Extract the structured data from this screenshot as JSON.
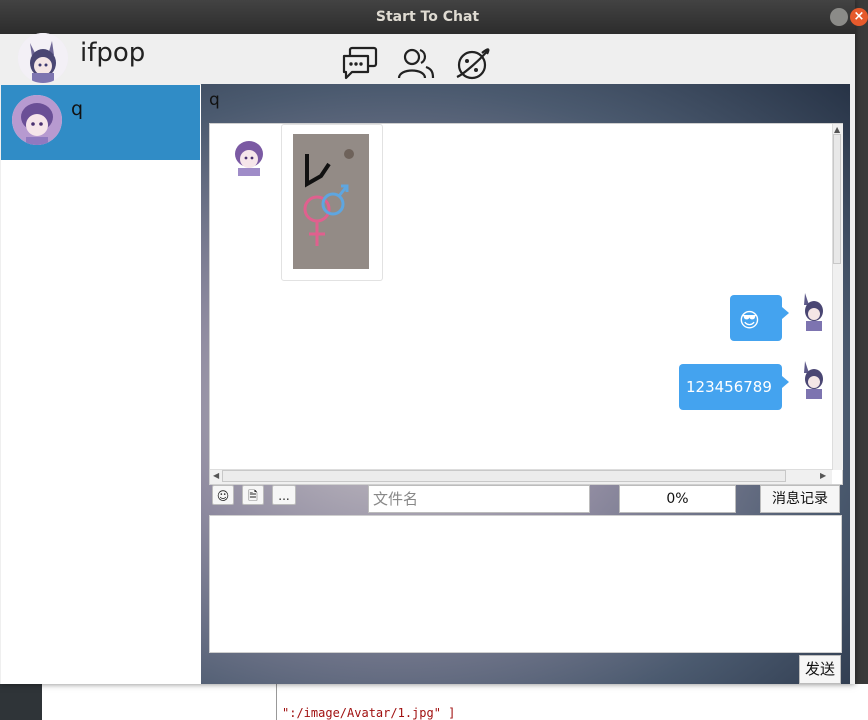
{
  "window": {
    "title": "Start To Chat"
  },
  "user": {
    "name": "ifpop"
  },
  "nav_icons": [
    "chat-icon",
    "contacts-icon",
    "planet-icon"
  ],
  "contacts": [
    {
      "name": "q",
      "selected": true
    }
  ],
  "chat": {
    "title": "q",
    "messages": [
      {
        "side": "left",
        "type": "image"
      },
      {
        "side": "right",
        "type": "emoji",
        "content": "😎"
      },
      {
        "side": "right",
        "type": "text",
        "content": "123456789"
      }
    ]
  },
  "toolbar": {
    "emoji_label": "☺",
    "file_label": "🗎",
    "more_label": "...",
    "file_name_placeholder": "文件名",
    "progress": "0%",
    "history_label": "消息记录"
  },
  "send_label": "发送",
  "background": {
    "code_snippet": "\":/image/Avatar/1.jpg\" ]"
  },
  "colors": {
    "accent": "#308cc6",
    "bubble": "#44a3ef",
    "close": "#e65a2c"
  }
}
